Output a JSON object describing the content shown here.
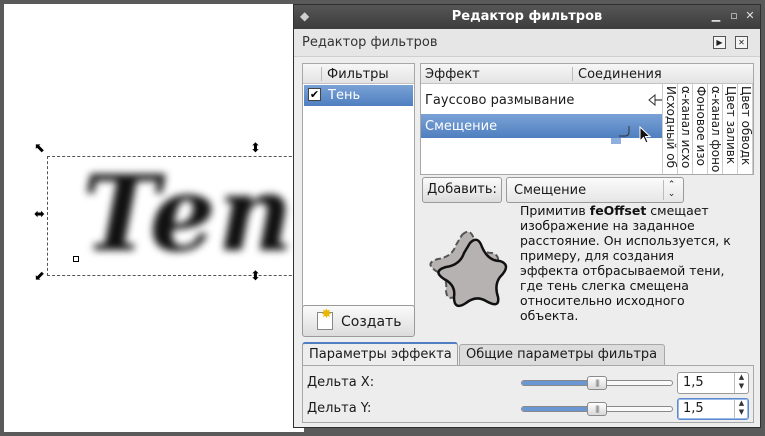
{
  "canvas": {
    "text": "Ten"
  },
  "dialog": {
    "title": "Редактор фильтров",
    "subheader_title": "Редактор фильтров"
  },
  "filters": {
    "header": "Фильтры",
    "items": [
      {
        "label": "Тень",
        "checked": true
      }
    ],
    "create_label": "Создать"
  },
  "effects": {
    "col_effect": "Эффект",
    "col_connections": "Соединения",
    "rows": [
      {
        "label": "Гауссово размывание"
      },
      {
        "label": "Смещение",
        "selected": true
      }
    ],
    "inputs": [
      "Исходный об",
      "α-канал исхо",
      "Фоновое изо",
      "α-канал фоно",
      "Цвет заливк",
      "Цвет обводк"
    ]
  },
  "add": {
    "button_label": "Добавить:",
    "selected_effect": "Смещение"
  },
  "description": {
    "prefix": "Примитив ",
    "keyword": "feOffset",
    "text": " смещает изображение на заданное расстояние. Он используется, к примеру, для создания эффекта отбрасываемой тени, где тень слегка смещена относительно исходного объекта."
  },
  "tabs": [
    {
      "label": "Параметры эффекта",
      "active": true
    },
    {
      "label": "Общие параметры фильтра",
      "active": false
    }
  ],
  "params": [
    {
      "label": "Дельта X:",
      "value": "1,5",
      "slider_fraction": 0.5
    },
    {
      "label": "Дельта Y:",
      "value": "1,5",
      "slider_fraction": 0.5
    }
  ],
  "colors": {
    "selection": "#4f7fc0",
    "titlebar": "#3c3c3c"
  }
}
